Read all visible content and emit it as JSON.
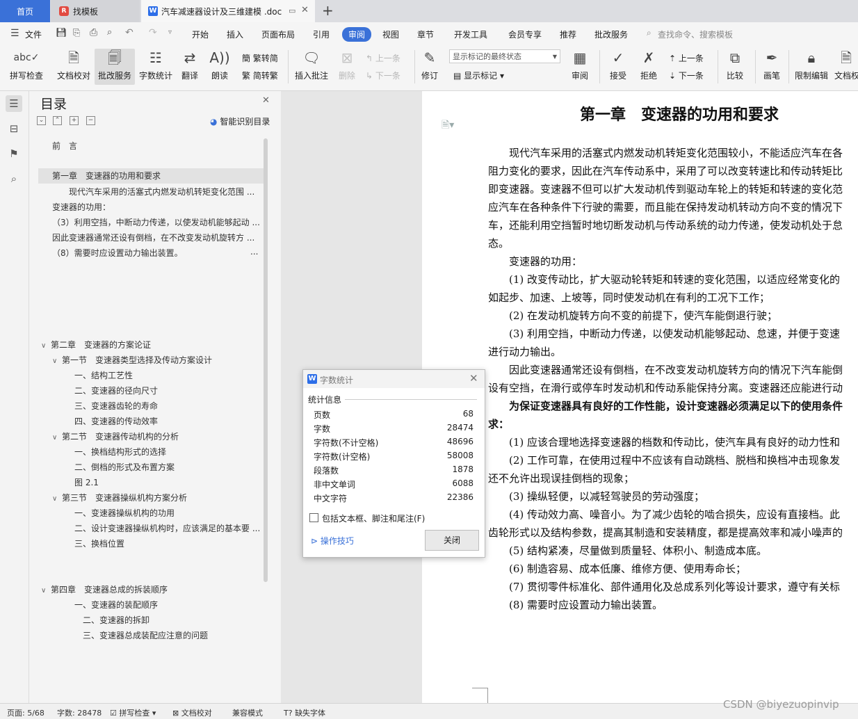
{
  "tabs": {
    "home": "首页",
    "template": "找模板",
    "doc": "汽车减速器设计及三维建模 .doc"
  },
  "menu": {
    "file": "文件",
    "items": [
      "开始",
      "插入",
      "页面布局",
      "引用",
      "审阅",
      "视图",
      "章节",
      "开发工具",
      "会员专享",
      "推荐",
      "批改服务"
    ],
    "search_placeholder": "查找命令、搜索模板"
  },
  "toolbar": {
    "spellcheck": "拼写检查",
    "proofread": "文档校对",
    "correct_service": "批改服务",
    "word_count": "字数统计",
    "translate": "翻译",
    "read_aloud": "朗读",
    "trad": "繁转简",
    "simp": "简转繁",
    "insert_comment": "插入批注",
    "delete": "删除",
    "prev": "上一条",
    "next": "下一条",
    "track": "修订",
    "markup_state": "显示标记的最终状态",
    "show_markup": "显示标记",
    "review": "审阅",
    "accept": "接受",
    "reject": "拒绝",
    "prev2": "上一条",
    "next2": "下一条",
    "compare": "比较",
    "pen": "画笔",
    "restrict": "限制编辑",
    "doc_rights": "文档权"
  },
  "nav": {
    "title": "目录",
    "smart": "智能识别目录",
    "items": [
      "前　言",
      "第一章　变速器的功用和要求",
      "现代汽车采用的活塞式内燃发动机转矩变化范围 ...",
      "变速器的功用：",
      "（3）利用空挡，中断动力传递，以使发动机能够起动 ...",
      "因此变速器通常还设有倒档，在不改变发动机旋转方 ...",
      "（8）需要时应设置动力输出装置。",
      "第二章　变速器的方案论证",
      "第一节　变速器类型选择及传动方案设计",
      "一、结构工艺性",
      "二、变速器的径向尺寸",
      "三、变速器齿轮的寿命",
      "四、变速器的传动效率",
      "第二节　变速器传动机构的分析",
      "一、换档结构形式的选择",
      "二、倒档的形式及布置方案",
      "图 2.1",
      "第三节　变速器操纵机构方案分析",
      "一、变速器操纵机构的功用",
      "二、设计变速器操纵机构时，应该满足的基本要 ...",
      "三、换档位置",
      "第四章　变速器总成的拆装顺序",
      "一、变速器的装配顺序",
      "二、变速器的拆卸",
      "三、变速器总成装配应注意的问题"
    ],
    "ellipsis": "..."
  },
  "document": {
    "heading": "第一章　变速器的功用和要求",
    "lines": [
      "　　现代汽车采用的活塞式内燃发动机转矩变化范围较小，不能适应汽车在各",
      "阻力变化的要求，因此在汽车传动系中，采用了可以改变转速比和传动转矩比",
      "即变速器。变速器不但可以扩大发动机传到驱动车轮上的转矩和转速的变化范",
      "应汽车在各种条件下行驶的需要，而且能在保持发动机转动方向不变的情况下",
      "车，还能利用空挡暂时地切断发动机与传动系统的动力传递，使发动机处于怠",
      "态。",
      "　　变速器的功用：",
      "　　(1) 改变传动比，扩大驱动轮转矩和转速的变化范围，以适应经常变化的",
      "如起步、加速、上坡等，同时使发动机在有利的工况下工作；",
      "　　(2) 在发动机旋转方向不变的前提下，使汽车能倒退行驶；",
      "　　(3) 利用空挡，中断动力传递，以使发动机能够起动、怠速，并便于变速",
      "进行动力输出。",
      "　　因此变速器通常还设有倒档，在不改变发动机旋转方向的情况下汽车能倒",
      "设有空挡，在滑行或停车时发动机和传动系能保持分离。变速器还应能进行动",
      "　　为保证变速器具有良好的工作性能，设计变速器必须满足以下的使用条件",
      "求：",
      "　　(1) 应该合理地选择变速器的档数和传动比，使汽车具有良好的动力性和",
      "　　(2) 工作可靠，在使用过程中不应该有自动跳档、脱档和换档冲击现象发",
      "还不允许出现误挂倒档的现象；",
      "　　(3) 操纵轻便，以减轻驾驶员的劳动强度；",
      "　　(4) 传动效力高、噪音小。为了减少齿轮的啮合损失，应设有直接档。此",
      "齿轮形式以及结构参数，提高其制造和安装精度，都是提高效率和减小噪声的",
      "　　(5) 结构紧凑，尽量做到质量轻、体积小、制造成本底。",
      "　　(6) 制造容易、成本低廉、维修方便、使用寿命长；",
      "　　(7) 贯彻零件标准化、部件通用化及总成系列化等设计要求，遵守有关标",
      "　　(8) 需要时应设置动力输出装置。"
    ]
  },
  "dialog": {
    "title": "字数统计",
    "section": "统计信息",
    "stats": [
      {
        "label": "页数",
        "value": "68"
      },
      {
        "label": "字数",
        "value": "28474"
      },
      {
        "label": "字符数(不计空格)",
        "value": "48696"
      },
      {
        "label": "字符数(计空格)",
        "value": "58008"
      },
      {
        "label": "段落数",
        "value": "1878"
      },
      {
        "label": "非中文单词",
        "value": "6088"
      },
      {
        "label": "中文字符",
        "value": "22386"
      }
    ],
    "checkbox": "包括文本框、脚注和尾注(F)",
    "tips": "操作技巧",
    "close": "关闭"
  },
  "status": {
    "page": "页面: 5/68",
    "words": "字数: 28478",
    "spell": "拼写检查",
    "proof": "文档校对",
    "compat": "兼容模式",
    "missing_font": "缺失字体"
  },
  "watermark": "CSDN @biyezuopinvip",
  "colors": {
    "accent": "#3a71d8",
    "wps_red": "#e24a40"
  }
}
